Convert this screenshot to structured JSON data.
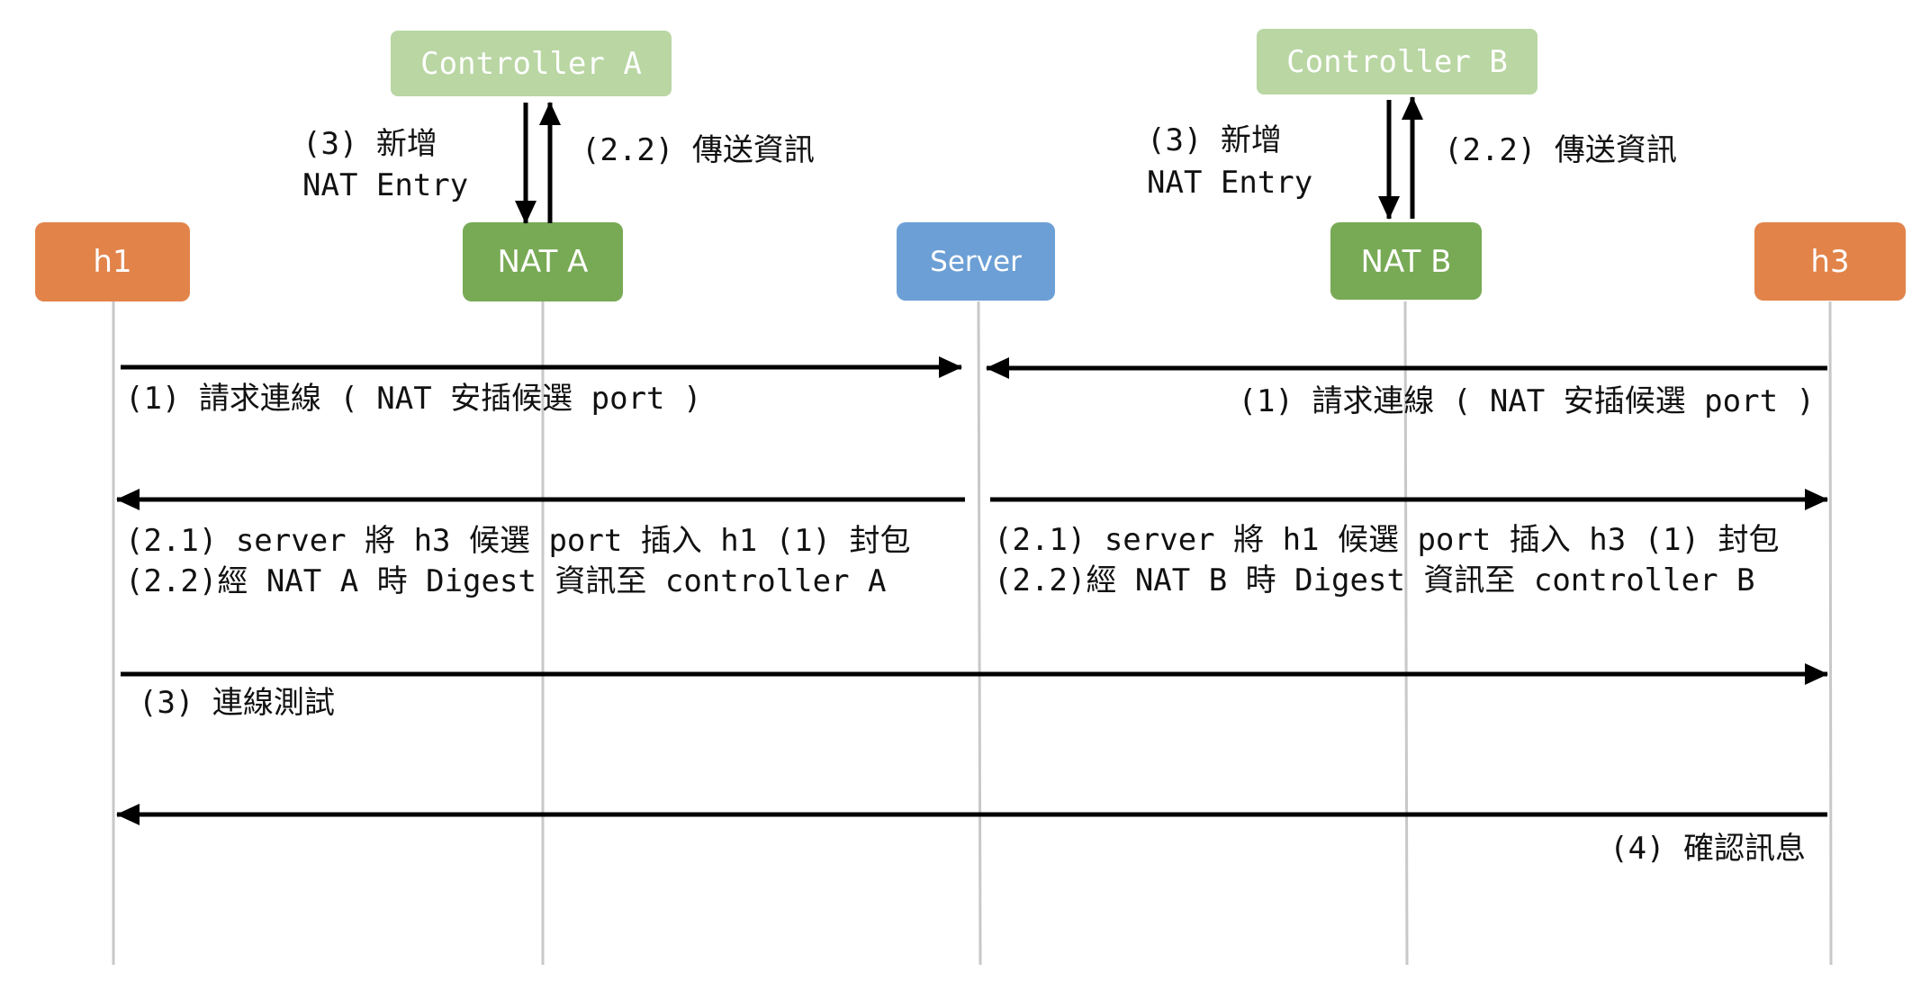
{
  "colors": {
    "host": "#e2844a",
    "nat": "#78aa55",
    "controller": "#b9d6a3",
    "server": "#6c9fd5",
    "lifeline": "#c8c8c8",
    "arrow": "#000000"
  },
  "participants": {
    "h1": "h1",
    "nat_a": "NAT A",
    "server": "Server",
    "nat_b": "NAT B",
    "h3": "h3",
    "controller_a": "Controller A",
    "controller_b": "Controller B"
  },
  "controller_links": {
    "a": {
      "add_line1": "(3) 新增",
      "add_line2": "NAT Entry",
      "send": "(2.2) 傳送資訊"
    },
    "b": {
      "add_line1": "(3) 新增",
      "add_line2": "NAT Entry",
      "send": "(2.2) 傳送資訊"
    }
  },
  "messages": {
    "m1_left": "(1) 請求連線 ( NAT 安插候選 port )",
    "m1_right": "(1) 請求連線 ( NAT 安插候選 port )",
    "m21_left": "(2.1) server 將 h3 候選 port 插入 h1 (1) 封包",
    "m22_left": "(2.2)經 NAT A 時 Digest 資訊至 controller A",
    "m21_right": "(2.1) server 將 h1 候選 port 插入 h3 (1) 封包",
    "m22_right": "(2.2)經 NAT B 時 Digest 資訊至 controller B",
    "m3": "(3) 連線測試",
    "m4": "(4) 確認訊息"
  }
}
